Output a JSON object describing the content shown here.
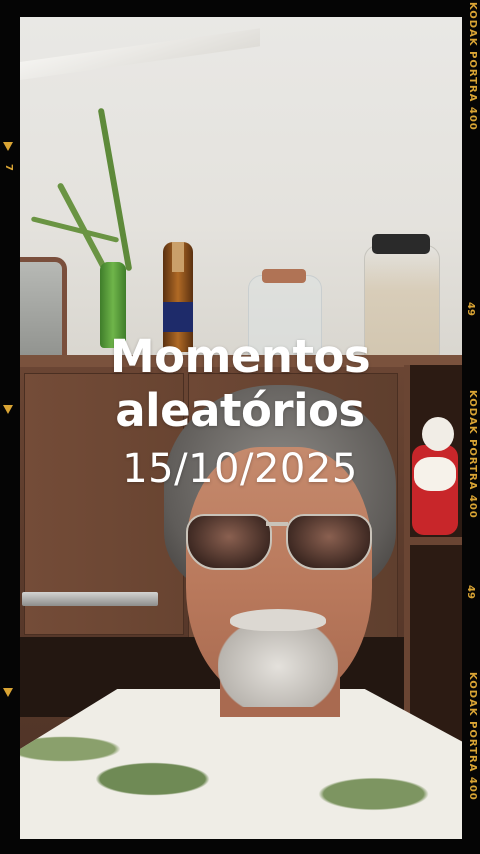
{
  "caption": {
    "title": "Momentos\naleatórios",
    "date": "15/10/2025"
  },
  "film_border": {
    "brand_text": "KODAK PORTRA 400",
    "frame_number": "49",
    "left_number": "7",
    "color": "#d9a434"
  }
}
